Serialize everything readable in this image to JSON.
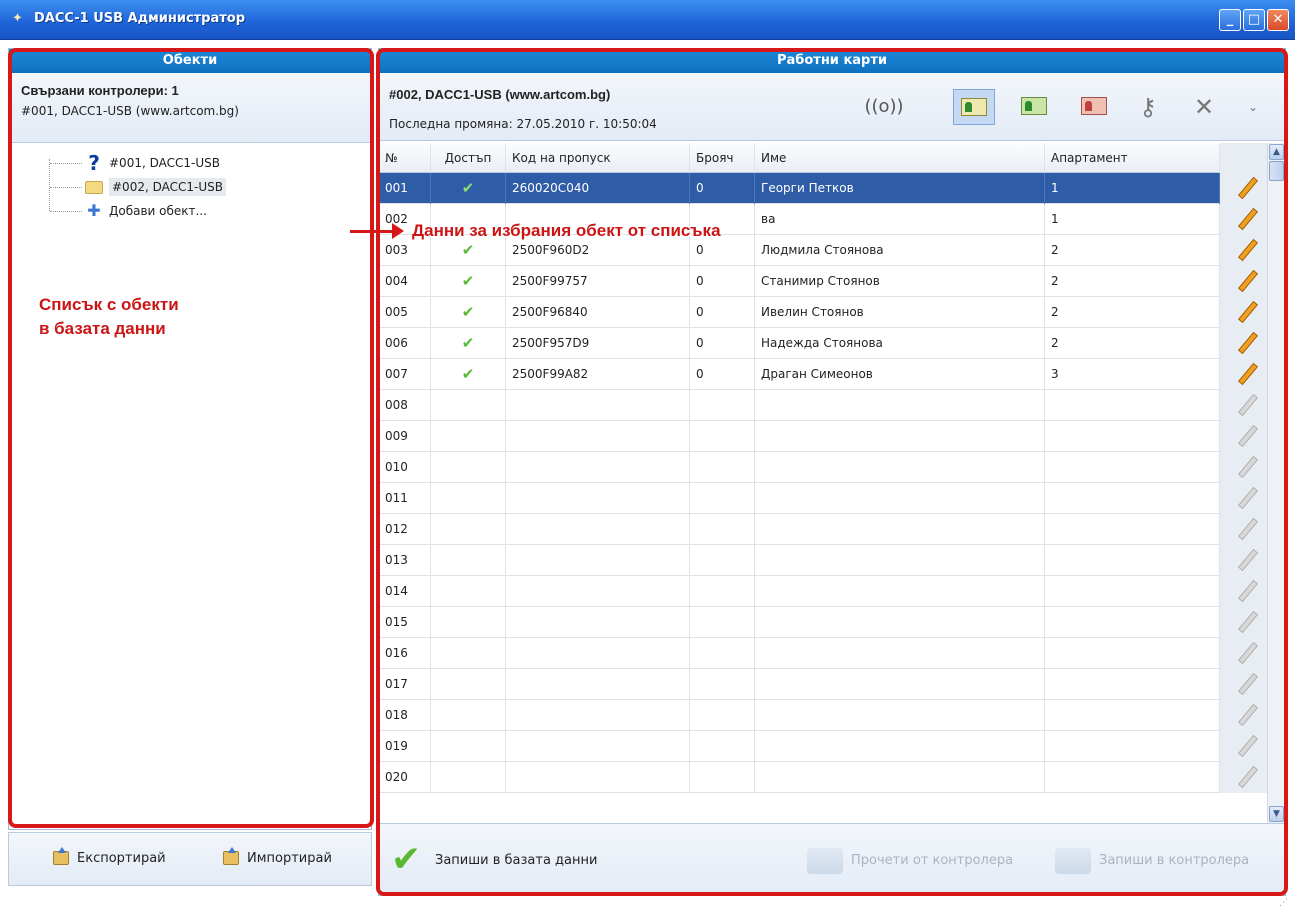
{
  "window": {
    "title": "DACC-1 USB Администратор",
    "minimize": "_",
    "maximize": "□",
    "close": "✕"
  },
  "left": {
    "header": "Обекти",
    "controllers_label": "Свързани контролери: 1",
    "controller_name": "#001, DACC1-USB (www.artcom.bg)",
    "tree": [
      {
        "label": "#001, DACC1-USB",
        "icon": "question-icon"
      },
      {
        "label": "#002, DACC1-USB",
        "icon": "folder-icon"
      },
      {
        "label": "Добави обект...",
        "icon": "plus-icon"
      }
    ],
    "annotation_line1": "Списък с обекти",
    "annotation_line2": "в базата данни",
    "export_label": "Експортирай",
    "import_label": "Импортирай"
  },
  "right": {
    "header": "Работни карти",
    "object_title": "#002, DACC1-USB (www.artcom.bg)",
    "last_change": "Последна промяна: 27.05.2010 г. 10:50:04",
    "annotation": "Данни за избрания обект от списъка",
    "columns": [
      "№",
      "Достъп",
      "Код на пропуск",
      "Брояч",
      "Име",
      "Апартамент"
    ],
    "rows": [
      {
        "n": "001",
        "access": "✔",
        "code": "260020C040",
        "count": "0",
        "name": "Георги Петков",
        "apt": "1"
      },
      {
        "n": "002",
        "access": "",
        "code": "",
        "count": "",
        "name": "ва",
        "apt": "1"
      },
      {
        "n": "003",
        "access": "✔",
        "code": "2500F960D2",
        "count": "0",
        "name": "Людмила Стоянова",
        "apt": "2"
      },
      {
        "n": "004",
        "access": "✔",
        "code": "2500F99757",
        "count": "0",
        "name": "Станимир Стоянов",
        "apt": "2"
      },
      {
        "n": "005",
        "access": "✔",
        "code": "2500F96840",
        "count": "0",
        "name": "Ивелин Стоянов",
        "apt": "2"
      },
      {
        "n": "006",
        "access": "✔",
        "code": "2500F957D9",
        "count": "0",
        "name": "Надежда Стоянова",
        "apt": "2"
      },
      {
        "n": "007",
        "access": "✔",
        "code": "2500F99A82",
        "count": "0",
        "name": "Драган Симеонов",
        "apt": "3"
      },
      {
        "n": "008",
        "access": "",
        "code": "",
        "count": "",
        "name": "",
        "apt": ""
      },
      {
        "n": "009",
        "access": "",
        "code": "",
        "count": "",
        "name": "",
        "apt": ""
      },
      {
        "n": "010",
        "access": "",
        "code": "",
        "count": "",
        "name": "",
        "apt": ""
      },
      {
        "n": "011",
        "access": "",
        "code": "",
        "count": "",
        "name": "",
        "apt": ""
      },
      {
        "n": "012",
        "access": "",
        "code": "",
        "count": "",
        "name": "",
        "apt": ""
      },
      {
        "n": "013",
        "access": "",
        "code": "",
        "count": "",
        "name": "",
        "apt": ""
      },
      {
        "n": "014",
        "access": "",
        "code": "",
        "count": "",
        "name": "",
        "apt": ""
      },
      {
        "n": "015",
        "access": "",
        "code": "",
        "count": "",
        "name": "",
        "apt": ""
      },
      {
        "n": "016",
        "access": "",
        "code": "",
        "count": "",
        "name": "",
        "apt": ""
      },
      {
        "n": "017",
        "access": "",
        "code": "",
        "count": "",
        "name": "",
        "apt": ""
      },
      {
        "n": "018",
        "access": "",
        "code": "",
        "count": "",
        "name": "",
        "apt": ""
      },
      {
        "n": "019",
        "access": "",
        "code": "",
        "count": "",
        "name": "",
        "apt": ""
      },
      {
        "n": "020",
        "access": "",
        "code": "",
        "count": "",
        "name": "",
        "apt": ""
      }
    ],
    "selected_row": "001",
    "save_db_label": "Запиши в базата данни",
    "read_ctrl_label": "Прочети от контролера",
    "write_ctrl_label": "Запиши в контролера"
  },
  "toolbar_icons": [
    "wireless-icon",
    "card-user-icon",
    "card-green-icon",
    "card-settings-icon",
    "keys-icon",
    "tools-icon",
    "more-icon"
  ],
  "colors": {
    "accent": "#0f6fc0",
    "selection": "#2f5ca7",
    "annotation": "#d81818",
    "check": "#57b83a"
  }
}
